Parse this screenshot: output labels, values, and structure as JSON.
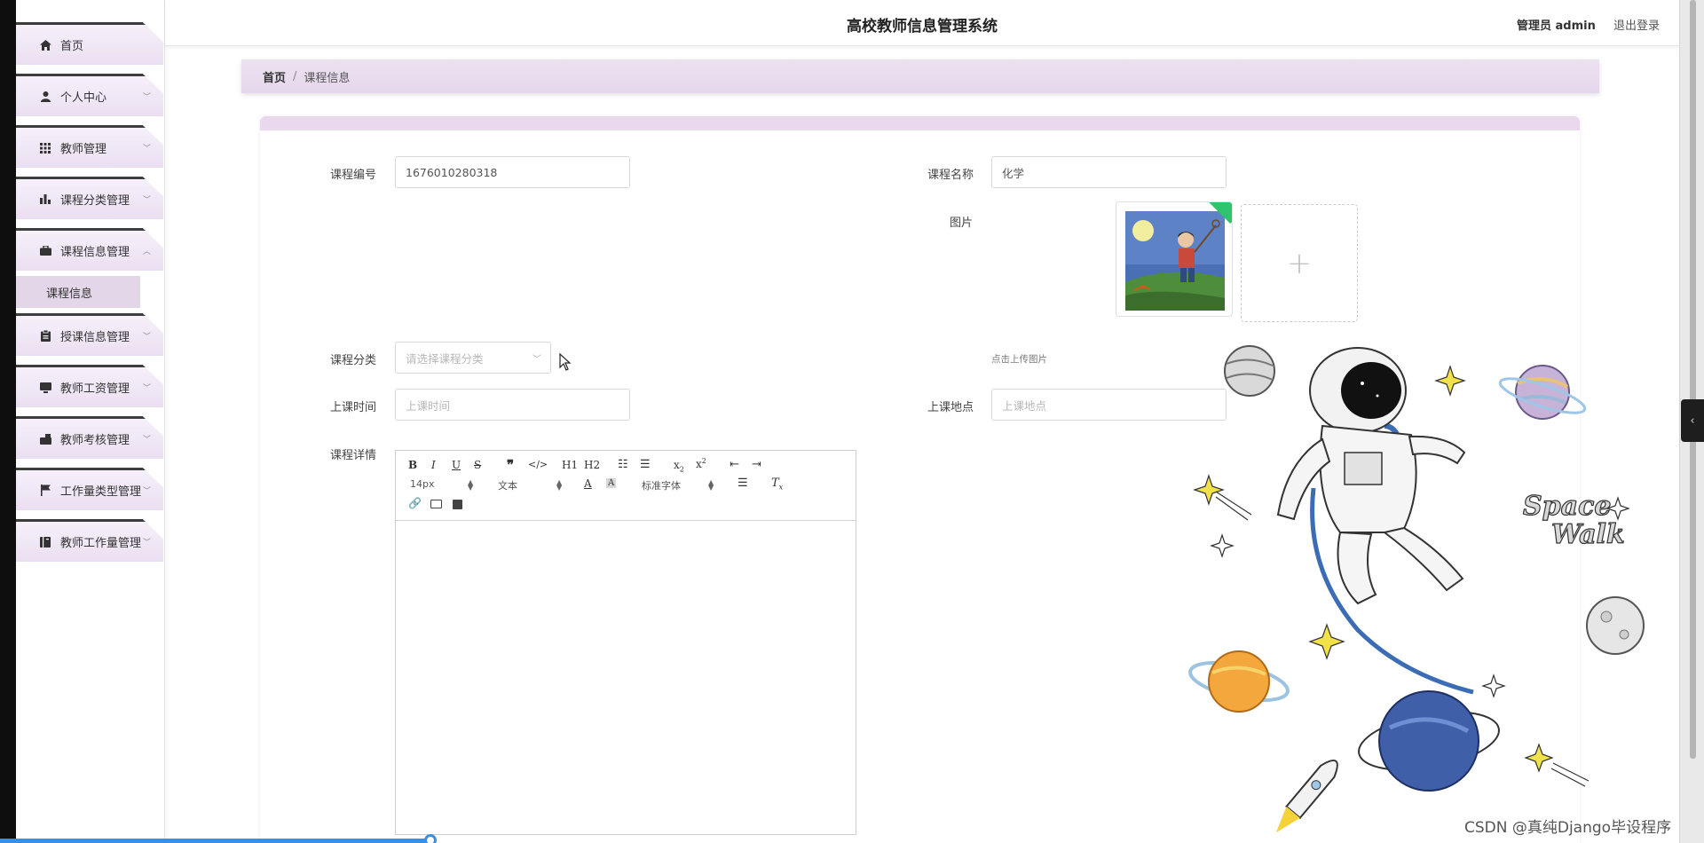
{
  "app": {
    "title": "高校教师信息管理系统",
    "user_label": "管理员 admin",
    "logout": "退出登录"
  },
  "sidebar": {
    "items": [
      {
        "label": "首页",
        "icon": "home-icon",
        "expandable": false
      },
      {
        "label": "个人中心",
        "icon": "user-icon",
        "expandable": true
      },
      {
        "label": "教师管理",
        "icon": "grid-icon",
        "expandable": true
      },
      {
        "label": "课程分类管理",
        "icon": "bar-chart-icon",
        "expandable": true
      },
      {
        "label": "课程信息管理",
        "icon": "briefcase-icon",
        "expandable": true,
        "expanded": true
      },
      {
        "label": "授课信息管理",
        "icon": "clipboard-icon",
        "expandable": true
      },
      {
        "label": "教师工资管理",
        "icon": "monitor-icon",
        "expandable": true
      },
      {
        "label": "教师考核管理",
        "icon": "suitcase-icon",
        "expandable": true
      },
      {
        "label": "工作量类型管理",
        "icon": "flag-icon",
        "expandable": true
      },
      {
        "label": "教师工作量管理",
        "icon": "book-icon",
        "expandable": true
      }
    ],
    "sub_item": "课程信息"
  },
  "breadcrumb": {
    "home": "首页",
    "separator": "/",
    "current": "课程信息"
  },
  "form": {
    "course_no": {
      "label": "课程编号",
      "value": "1676010280318"
    },
    "course_name": {
      "label": "课程名称",
      "value": "化学"
    },
    "image": {
      "label": "图片",
      "upload_tip": "点击上传图片",
      "plus": "+"
    },
    "category": {
      "label": "课程分类",
      "placeholder": "请选择课程分类"
    },
    "time": {
      "label": "上课时间",
      "placeholder": "上课时间"
    },
    "location": {
      "label": "上课地点",
      "placeholder": "上课地点"
    },
    "detail": {
      "label": "课程详情"
    }
  },
  "editor": {
    "font_size": "14px",
    "text_type": "文本",
    "font_family": "标准字体",
    "h1": "H1",
    "h2": "H2"
  },
  "watermark": "CSDN @真纯Django毕设程序",
  "colors": {
    "menu_bg": "#ecdff2",
    "breadcrumb_bg": "#e8dbee",
    "card_top": "#ead9ee",
    "progress": "#3b8fe3"
  }
}
